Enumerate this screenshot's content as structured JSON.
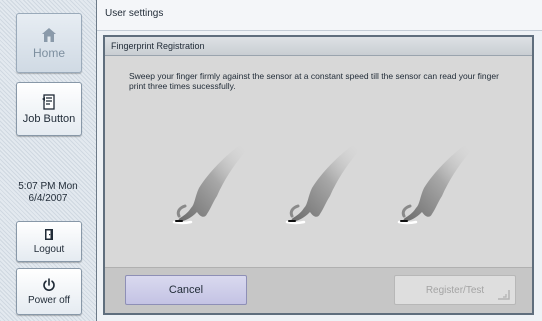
{
  "sidebar": {
    "home_label": "Home",
    "job_label": "Job Button",
    "clock_time": "5:07 PM  Mon",
    "clock_date": "6/4/2007",
    "logout_label": "Logout",
    "power_label": "Power off"
  },
  "header": {
    "title": "User settings"
  },
  "dialog": {
    "title": "Fingerprint Registration",
    "instructions": "Sweep your finger firmly against the sensor at a constant speed till the sensor can read your finger print three times sucessfully.",
    "cancel_label": "Cancel",
    "register_label": "Register/Test"
  },
  "icons": [
    "home-icon",
    "job-button-icon",
    "logout-icon",
    "power-icon",
    "finger-swipe-icon"
  ],
  "colors": {
    "cancel_button": "#c9c8e8",
    "dialog_bg": "#d8d8d8",
    "disabled_text": "#a4a4a4"
  }
}
